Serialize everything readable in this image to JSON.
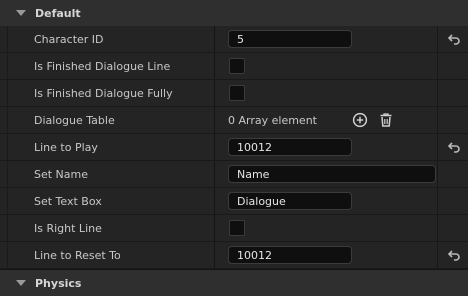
{
  "sections": {
    "default_label": "Default",
    "physics_label": "Physics"
  },
  "properties": [
    {
      "label": "Character ID",
      "type": "number",
      "value": "5",
      "resettable": true
    },
    {
      "label": "Is Finished Dialogue Line",
      "type": "checkbox",
      "checked": false
    },
    {
      "label": "Is Finished Dialogue Fully",
      "type": "checkbox",
      "checked": false
    },
    {
      "label": "Dialogue Table",
      "type": "array",
      "value": "0 Array element"
    },
    {
      "label": "Line to Play",
      "type": "number",
      "value": "10012",
      "resettable": true
    },
    {
      "label": "Set Name",
      "type": "text",
      "value": "Name"
    },
    {
      "label": "Set Text Box",
      "type": "text",
      "value": "Dialogue"
    },
    {
      "label": "Is Right Line",
      "type": "checkbox",
      "checked": false
    },
    {
      "label": "Line to Reset To",
      "type": "number",
      "value": "10012",
      "resettable": true
    }
  ],
  "icons": {
    "expand": "chevron-down-icon",
    "add": "plus-circle-icon",
    "delete": "trash-icon",
    "reset": "reset-arrow-icon"
  },
  "colors": {
    "panel_bg": "#242424",
    "header_bg": "#2f2f2f",
    "field_bg": "#0f0f0f",
    "text": "#c8c8c8"
  }
}
